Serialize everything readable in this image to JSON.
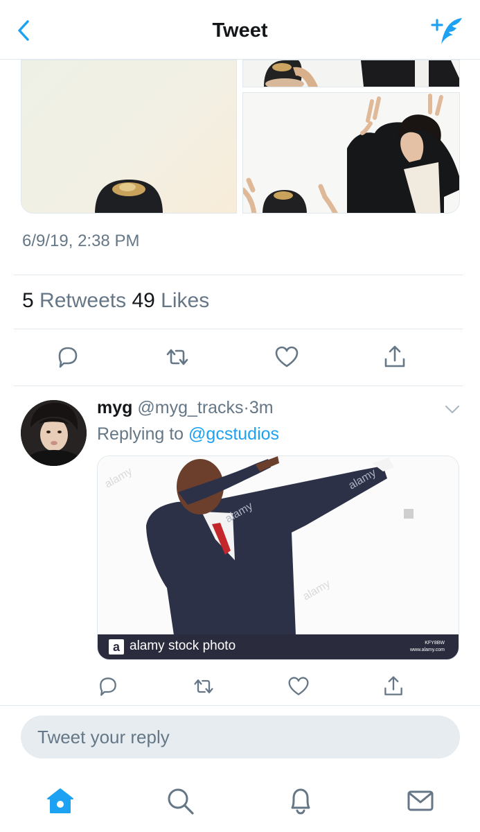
{
  "header": {
    "title": "Tweet",
    "back_icon": "chevron-left-icon",
    "compose_icon": "compose-tweet-icon"
  },
  "colors": {
    "accent": "#1da1f2",
    "secondary_text": "#657786",
    "divider": "#e1e8ed",
    "reply_box_bg": "#e6ecf0"
  },
  "tweet": {
    "timestamp": "6/9/19, 2:38 PM",
    "retweets_count": "5",
    "retweets_label": "Retweets",
    "likes_count": "49",
    "likes_label": "Likes"
  },
  "reply": {
    "display_name": "myg",
    "handle": "@myg_tracks",
    "separator": "·",
    "time": "3m",
    "replying_prefix": "Replying to",
    "replying_to": "@gcstudios",
    "media_watermark": "alamy stock photo",
    "media_logo": "a",
    "media_code_line1": "KFY8BW",
    "media_code_line2": "www.alamy.com"
  },
  "composer": {
    "placeholder": "Tweet your reply"
  },
  "tabbar": {
    "items": [
      "home-icon",
      "search-icon",
      "notifications-icon",
      "messages-icon"
    ],
    "active": "home-icon"
  }
}
